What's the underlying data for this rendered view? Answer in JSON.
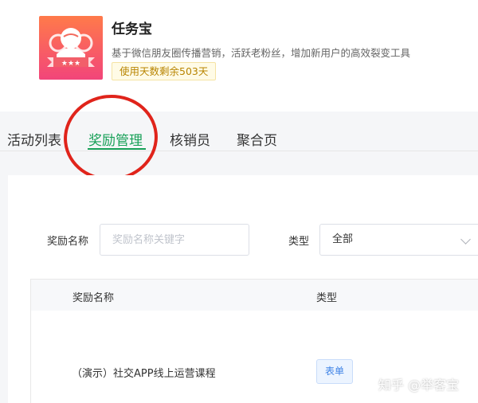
{
  "app": {
    "name": "任务宝",
    "description": "基于微信朋友圈传播营销，活跃老粉丝，增加新用户的高效裂变工具",
    "remaining_days": "使用天数剩余503天"
  },
  "tabs": [
    {
      "label": "活动列表"
    },
    {
      "label": "奖励管理",
      "active": true
    },
    {
      "label": "核销员"
    },
    {
      "label": "聚合页"
    }
  ],
  "filter": {
    "name_label": "奖励名称",
    "name_placeholder": "奖励名称关键字",
    "type_label": "类型",
    "type_value": "全部"
  },
  "table": {
    "columns": [
      "奖励名称",
      "类型"
    ],
    "rows": [
      {
        "name": "（演示）社交APP线上运营课程",
        "type": "表单"
      }
    ]
  },
  "watermark": "知乎 @举客宝",
  "colors": {
    "accent": "#18a058",
    "annotation_circle": "#e0241b",
    "badge_bg": "#fffbe6",
    "badge_text": "#b88400",
    "tag_text": "#3f83e6"
  }
}
